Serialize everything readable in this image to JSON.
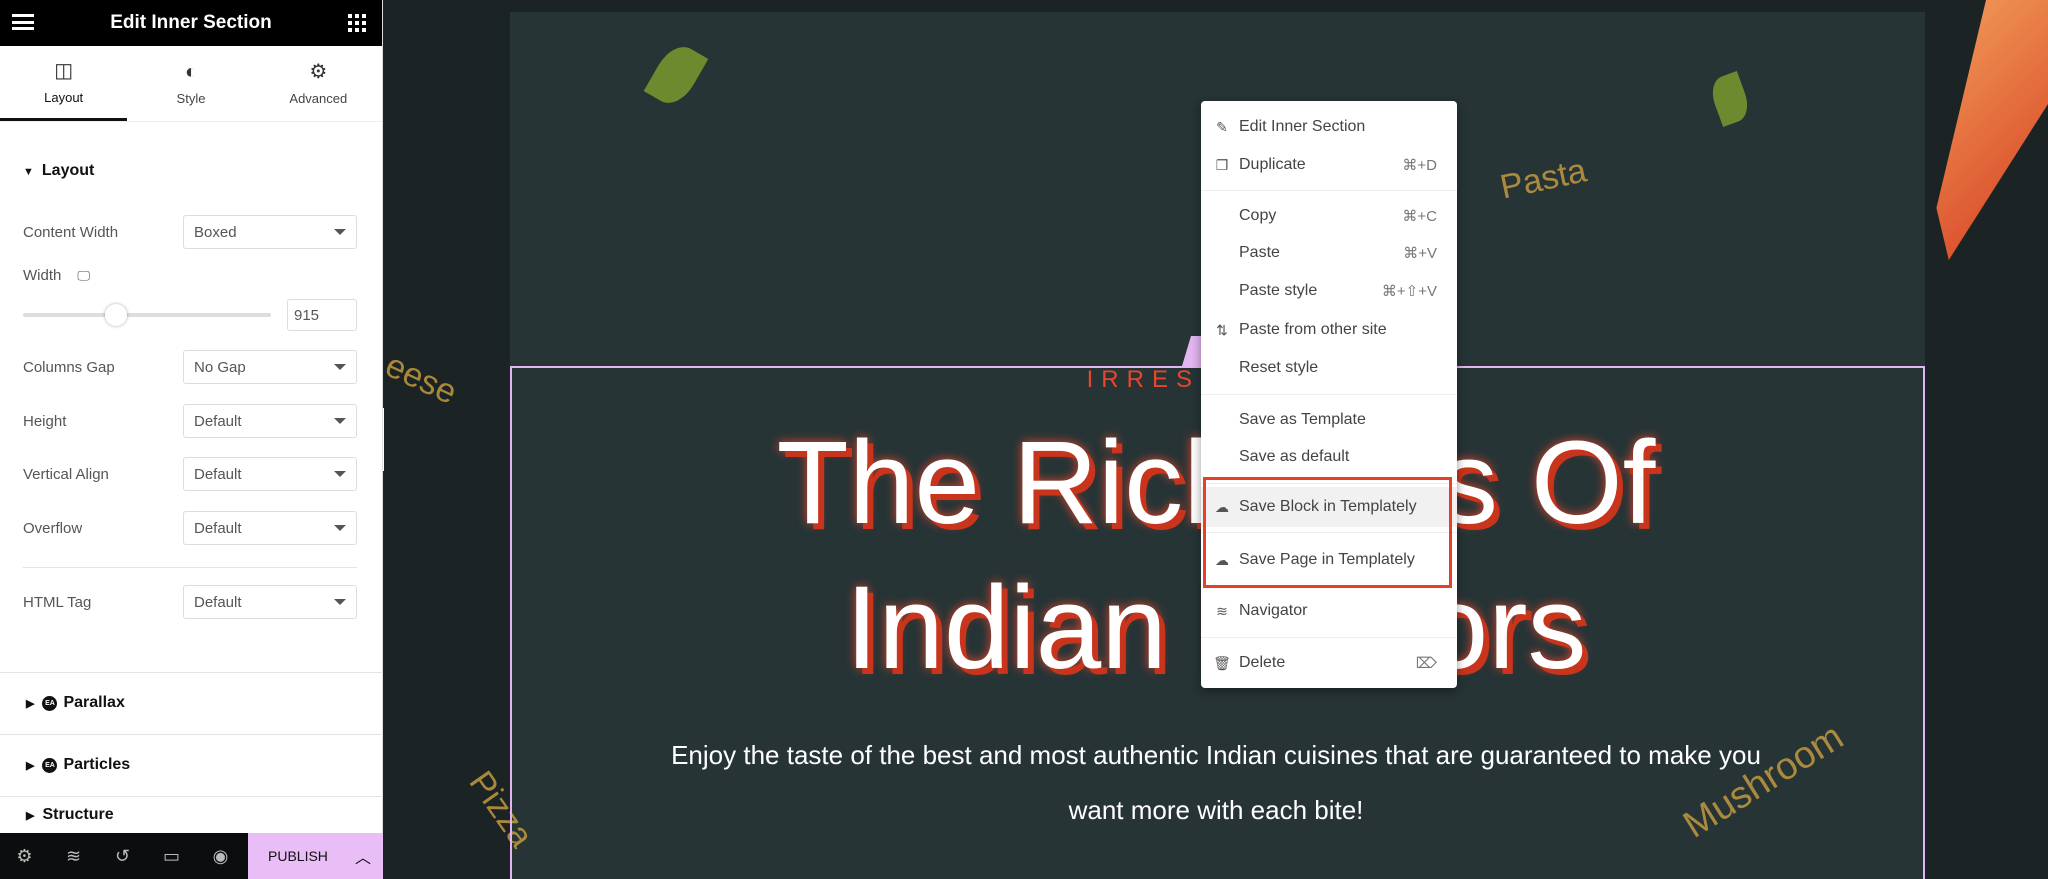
{
  "sidebar": {
    "title": "Edit Inner Section",
    "tabs": [
      {
        "label": "Layout",
        "icon": "columns-icon",
        "active": true
      },
      {
        "label": "Style",
        "icon": "half-circle-icon"
      },
      {
        "label": "Advanced",
        "icon": "gear-icon"
      }
    ],
    "section_title": "Layout",
    "fields": {
      "content_width": {
        "label": "Content Width",
        "value": "Boxed"
      },
      "width": {
        "label": "Width",
        "value": "915",
        "slider_percent": 30
      },
      "columns_gap": {
        "label": "Columns Gap",
        "value": "No Gap"
      },
      "height": {
        "label": "Height",
        "value": "Default"
      },
      "vertical_align": {
        "label": "Vertical Align",
        "value": "Default"
      },
      "overflow": {
        "label": "Overflow",
        "value": "Default"
      },
      "html_tag": {
        "label": "HTML Tag",
        "value": "Default"
      }
    },
    "collapsed_sections": [
      "Parallax",
      "Particles",
      "Structure"
    ],
    "ea_badge": "EA",
    "footer": {
      "publish_label": "PUBLISH"
    }
  },
  "canvas": {
    "eyebrow": "IRRESISTIBLE",
    "heading_line1": "The Richness Of",
    "heading_line2": "Indian Flavors",
    "paragraph_line1": "Enjoy the taste of the best and most authentic Indian cuisines that are guaranteed to make you",
    "paragraph_line2": "want more with each bite!",
    "decor": {
      "pasta": "Pasta",
      "cheese": "eese",
      "pizza": "Pizza",
      "mushroom": "Mushroom"
    }
  },
  "context_menu": {
    "items": [
      {
        "label": "Edit Inner Section",
        "icon": "pencil-icon"
      },
      {
        "label": "Duplicate",
        "shortcut": "⌘+D",
        "icon": "duplicate-icon"
      },
      {
        "label": "Copy",
        "shortcut": "⌘+C"
      },
      {
        "label": "Paste",
        "shortcut": "⌘+V"
      },
      {
        "label": "Paste style",
        "shortcut": "⌘+⇧+V"
      },
      {
        "label": "Paste from other site",
        "icon": "transfer-icon"
      },
      {
        "label": "Reset style"
      },
      {
        "label": "Save as Template"
      },
      {
        "label": "Save as default"
      },
      {
        "label": "Save Block in Templately",
        "icon": "cloud-icon",
        "highlighted": true
      },
      {
        "label": "Save Page in Templately",
        "icon": "cloud-icon"
      },
      {
        "label": "Navigator",
        "icon": "layers-icon"
      },
      {
        "label": "Delete",
        "shortcut": "⌦",
        "icon": "trash-icon"
      }
    ],
    "highlight_color": "#e83e2c"
  },
  "colors": {
    "publish_bg": "#e9bdf6",
    "canvas_bg": "#263436",
    "accent_red": "#e8462c"
  }
}
